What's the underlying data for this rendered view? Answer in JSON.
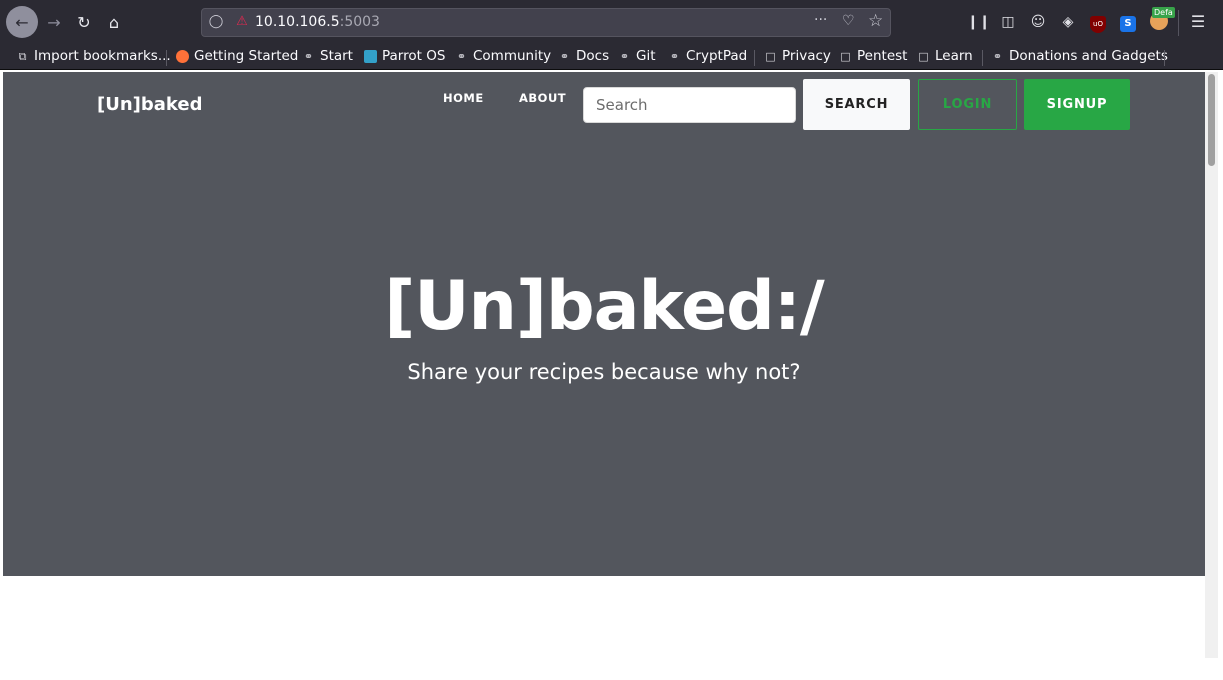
{
  "browser": {
    "url_host": "10.10.106.5",
    "url_port": ":5003",
    "icons": {
      "back": "arrow-left-icon",
      "forward": "arrow-right-icon",
      "reload": "reload-icon",
      "home": "home-icon",
      "menu": "hamburger-menu-icon"
    },
    "extension_badge": "Defa"
  },
  "bookmarks": [
    {
      "label": "Import bookmarks..."
    },
    {
      "label": "Getting Started"
    },
    {
      "label": "Start"
    },
    {
      "label": "Parrot OS"
    },
    {
      "label": "Community"
    },
    {
      "label": "Docs"
    },
    {
      "label": "Git"
    },
    {
      "label": "CryptPad"
    },
    {
      "label": "Privacy"
    },
    {
      "label": "Pentest"
    },
    {
      "label": "Learn"
    },
    {
      "label": "Donations and Gadgets"
    }
  ],
  "site": {
    "brand": "[Un]baked",
    "nav": {
      "home": "HOME",
      "about": "ABOUT"
    },
    "search_placeholder": "Search",
    "search_button": "SEARCH",
    "login_button": "LOGIN",
    "signup_button": "SIGNUP",
    "hero_title": "[Un]baked:/",
    "hero_subtitle": "Share your recipes because why not?"
  },
  "colors": {
    "hero_bg": "#53565d",
    "accent_green": "#28a745",
    "browser_chrome": "#2b2a33"
  }
}
